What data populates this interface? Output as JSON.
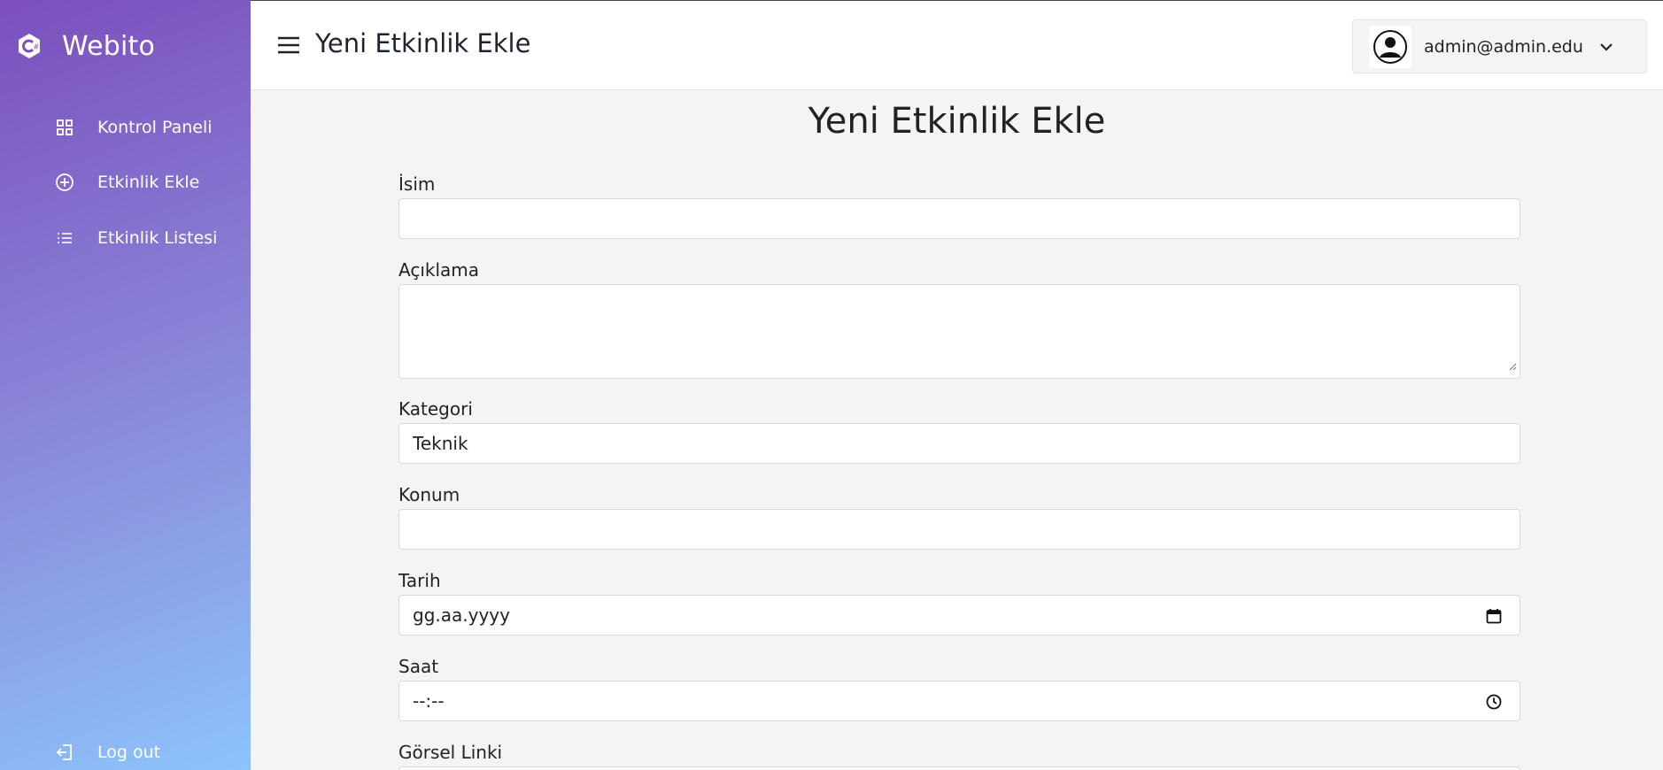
{
  "app": {
    "brand": "Webito"
  },
  "sidebar": {
    "items": [
      {
        "label": "Kontrol Paneli",
        "icon": "grid-icon"
      },
      {
        "label": "Etkinlik Ekle",
        "icon": "plus-circle-icon"
      },
      {
        "label": "Etkinlik Listesi",
        "icon": "list-icon"
      }
    ],
    "logout_label": "Log out"
  },
  "header": {
    "title": "Yeni Etkinlik Ekle",
    "user_email": "admin@admin.edu"
  },
  "form": {
    "title": "Yeni Etkinlik Ekle",
    "name_label": "İsim",
    "name_value": "",
    "description_label": "Açıklama",
    "description_value": "",
    "category_label": "Kategori",
    "category_value": "Teknik",
    "location_label": "Konum",
    "location_value": "",
    "date_label": "Tarih",
    "date_placeholder": "gg.aa.yyyy",
    "time_label": "Saat",
    "time_placeholder": "--:--",
    "image_link_label": "Görsel Linki"
  },
  "colors": {
    "sidebar_gradient_start": "#7b4fbd",
    "sidebar_gradient_end": "#8cc4fb",
    "page_background": "#f4f4f4"
  }
}
